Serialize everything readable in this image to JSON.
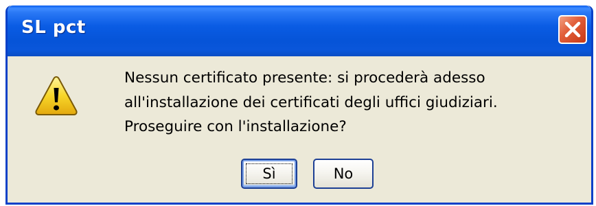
{
  "window": {
    "title": "SL pct",
    "close_icon": "close-icon"
  },
  "message": {
    "icon": "warning-icon",
    "lines": [
      "Nessun certificato presente: si procederà adesso",
      "all'installazione dei certificati degli uffici giudiziari.",
      "Proseguire con l'installazione?"
    ]
  },
  "buttons": {
    "yes_label": "Sì",
    "no_label": "No"
  },
  "colors": {
    "titlebar": "#0a5ce4",
    "dialog_bg": "#ece9d8",
    "close_button": "#e2603c",
    "warning": "#f7d629"
  }
}
